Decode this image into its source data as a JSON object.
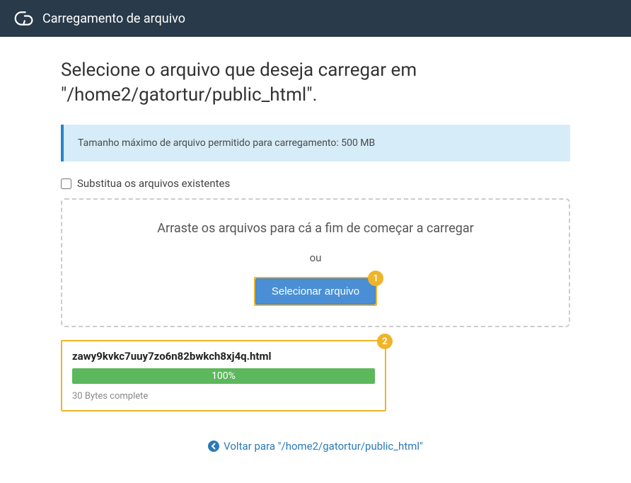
{
  "header": {
    "title": "Carregamento de arquivo"
  },
  "heading": "Selecione o arquivo que deseja carregar em \"/home2/gatortur/public_html\".",
  "info": "Tamanho máximo de arquivo permitido para carregamento: 500 MB",
  "overwrite_label": "Substitua os arquivos existentes",
  "dropzone": {
    "drag_text": "Arraste os arquivos para cá a fim de começar a carregar",
    "or": "ou",
    "select_label": "Selecionar arquivo",
    "badge": "1"
  },
  "upload": {
    "badge": "2",
    "filename": "zawy9kvkc7uuy7zo6n82bwkch8xj4q.html",
    "progress_text": "100%",
    "status": "30 Bytes complete"
  },
  "back": {
    "label": "Voltar para \"/home2/gatortur/public_html\""
  }
}
